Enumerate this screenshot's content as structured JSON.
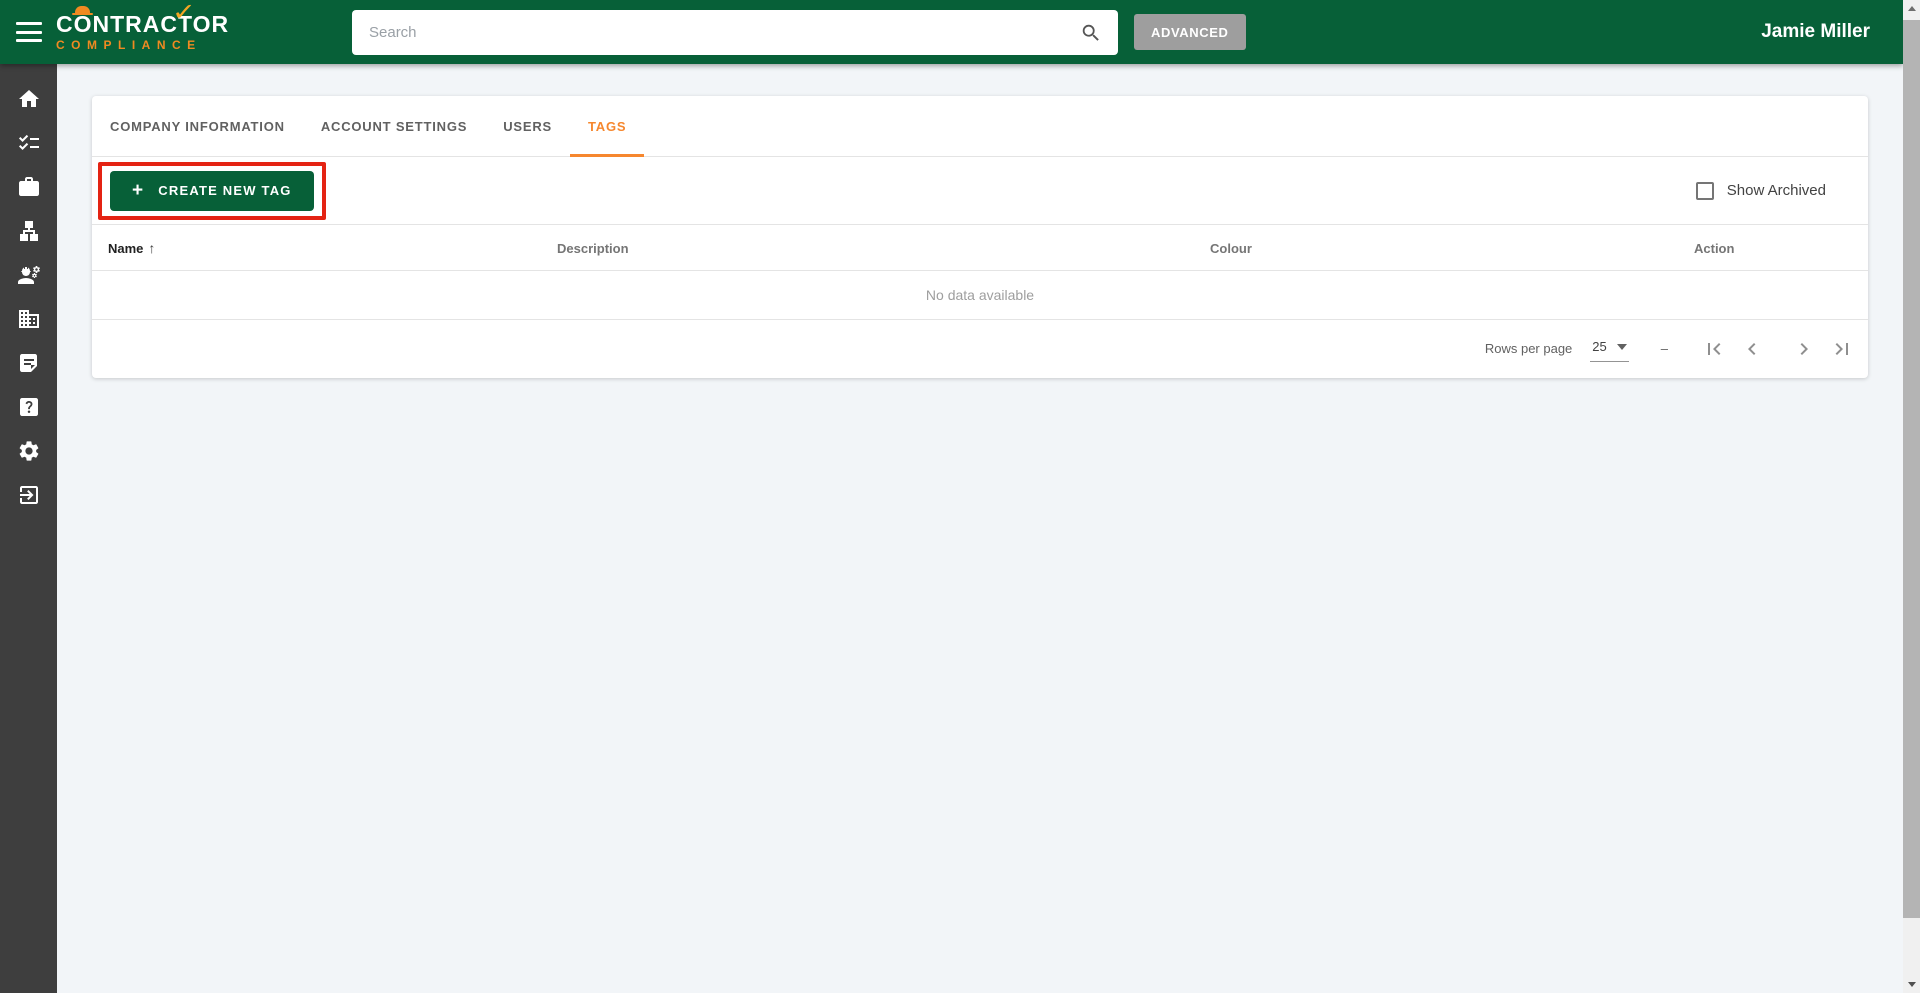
{
  "header": {
    "logo_part1": "C",
    "logo_line1": "CONTRACTOR",
    "logo_line2": "COMPLIANCE",
    "search_placeholder": "Search",
    "advanced_label": "ADVANCED",
    "user_name": "Jamie Miller"
  },
  "colors": {
    "brand_green": "#076038",
    "brand_orange": "#F6872E",
    "sidebar_bg": "#3E3E3E",
    "page_bg": "#F2F5F8",
    "annotation_red": "#E42313",
    "advanced_gray": "#9E9E9E"
  },
  "sidebar": {
    "items": [
      {
        "icon": "home-icon"
      },
      {
        "icon": "checklist-icon"
      },
      {
        "icon": "briefcase-icon"
      },
      {
        "icon": "org-chart-icon"
      },
      {
        "icon": "worker-icon"
      },
      {
        "icon": "building-icon"
      },
      {
        "icon": "document-icon"
      },
      {
        "icon": "help-icon"
      },
      {
        "icon": "settings-icon"
      },
      {
        "icon": "logout-icon"
      }
    ]
  },
  "tabs": [
    {
      "label": "COMPANY INFORMATION",
      "active": false
    },
    {
      "label": "ACCOUNT SETTINGS",
      "active": false
    },
    {
      "label": "USERS",
      "active": false
    },
    {
      "label": "TAGS",
      "active": true
    }
  ],
  "toolbar": {
    "create_tag_label": "CREATE NEW TAG",
    "plus_icon": "+",
    "show_archived_label": "Show Archived",
    "show_archived_checked": false
  },
  "table": {
    "columns": [
      "Name",
      "Description",
      "Colour",
      "Action"
    ],
    "sort_column": "Name",
    "sort_indicator": "↑",
    "rows": [],
    "empty_message": "No data available"
  },
  "pagination": {
    "rows_per_page_label": "Rows per page",
    "rows_per_page_value": "25",
    "range": "–"
  }
}
